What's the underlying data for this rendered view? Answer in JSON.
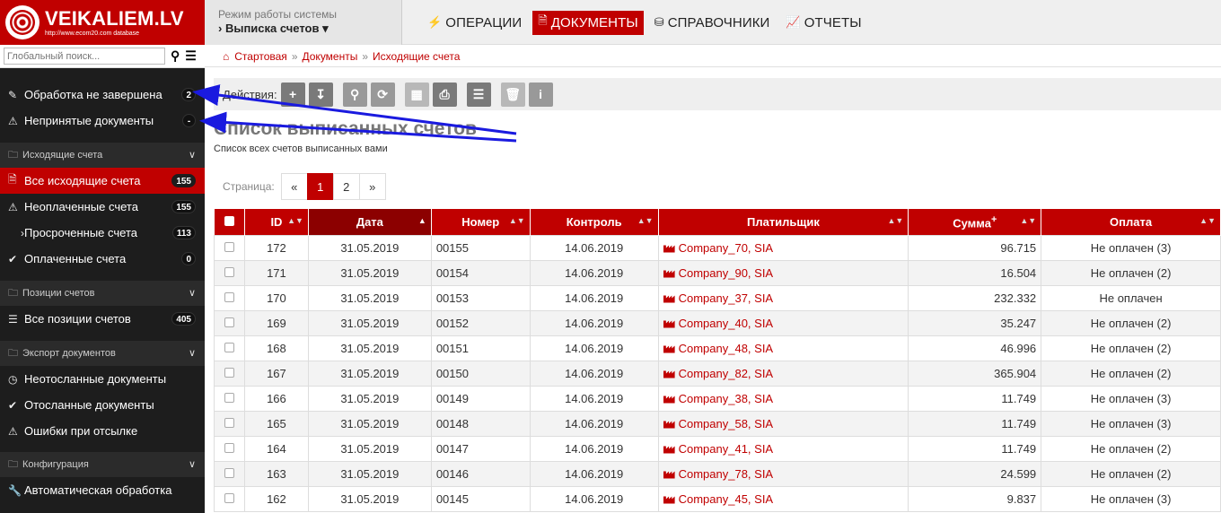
{
  "brand": {
    "title": "VEIKALIEM.LV",
    "subtitle": "http://www.ecom20.com database"
  },
  "search": {
    "placeholder": "Глобальный поиск..."
  },
  "sidebar": {
    "status": [
      {
        "label": "Обработка не завершена",
        "badge": "2",
        "icon": "edit-icon"
      },
      {
        "label": "Непринятые документы",
        "badge": "-",
        "icon": "warning-icon"
      }
    ],
    "groups": [
      {
        "title": "Исходящие счета",
        "items": [
          {
            "label": "Все исходящие счета",
            "badge": "155",
            "icon": "document-icon",
            "active": true
          },
          {
            "label": "Неоплаченные счета",
            "badge": "155",
            "icon": "warning-icon"
          },
          {
            "label": "Просроченные счета",
            "badge": "113",
            "icon": "chevron-right-icon"
          },
          {
            "label": "Оплаченные счета",
            "badge": "0",
            "icon": "check-icon"
          }
        ]
      },
      {
        "title": "Позиции счетов",
        "items": [
          {
            "label": "Все позиции счетов",
            "badge": "405",
            "icon": "list-icon"
          }
        ]
      },
      {
        "title": "Экспорт документов",
        "items": [
          {
            "label": "Неотосланные документы",
            "icon": "clock-icon"
          },
          {
            "label": "Отосланные документы",
            "icon": "check-icon"
          },
          {
            "label": "Ошибки при отсылке",
            "icon": "warning-icon"
          }
        ]
      },
      {
        "title": "Конфигурация",
        "items": [
          {
            "label": "Автоматическая обработка",
            "icon": "wrench-icon"
          }
        ]
      }
    ]
  },
  "topbar": {
    "mode_caption": "Режим работы системы",
    "mode_value": "Выписка счетов",
    "nav": [
      {
        "label": "ОПЕРАЦИИ",
        "icon": "bolt-icon"
      },
      {
        "label": "ДОКУМЕНТЫ",
        "icon": "document-icon",
        "active": true
      },
      {
        "label": "СПРАВОЧНИКИ",
        "icon": "database-icon"
      },
      {
        "label": "ОТЧЕТЫ",
        "icon": "chart-icon"
      }
    ]
  },
  "breadcrumb": [
    "Стартовая",
    "Документы",
    "Исходящие счета"
  ],
  "actions": {
    "caption": "Действия:"
  },
  "page": {
    "title": "Список выписанных счетов",
    "subtitle": "Список всех счетов выписанных вами"
  },
  "pager": {
    "caption": "Страница:",
    "prev": "«",
    "pages": [
      "1",
      "2"
    ],
    "next": "»",
    "current": "1"
  },
  "table": {
    "columns": [
      "ID",
      "Дата",
      "Номер",
      "Контроль",
      "Платильщик",
      "Сумма",
      "Оплата"
    ],
    "sum_marker": "+",
    "rows": [
      {
        "id": "172",
        "date": "31.05.2019",
        "num": "00155",
        "ctrl": "14.06.2019",
        "payer": "Company_70, SIA",
        "sum": "96.715",
        "pay": "Не оплачен (3)"
      },
      {
        "id": "171",
        "date": "31.05.2019",
        "num": "00154",
        "ctrl": "14.06.2019",
        "payer": "Company_90, SIA",
        "sum": "16.504",
        "pay": "Не оплачен (2)"
      },
      {
        "id": "170",
        "date": "31.05.2019",
        "num": "00153",
        "ctrl": "14.06.2019",
        "payer": "Company_37, SIA",
        "sum": "232.332",
        "pay": "Не оплачен"
      },
      {
        "id": "169",
        "date": "31.05.2019",
        "num": "00152",
        "ctrl": "14.06.2019",
        "payer": "Company_40, SIA",
        "sum": "35.247",
        "pay": "Не оплачен (2)"
      },
      {
        "id": "168",
        "date": "31.05.2019",
        "num": "00151",
        "ctrl": "14.06.2019",
        "payer": "Company_48, SIA",
        "sum": "46.996",
        "pay": "Не оплачен (2)"
      },
      {
        "id": "167",
        "date": "31.05.2019",
        "num": "00150",
        "ctrl": "14.06.2019",
        "payer": "Company_82, SIA",
        "sum": "365.904",
        "pay": "Не оплачен (2)"
      },
      {
        "id": "166",
        "date": "31.05.2019",
        "num": "00149",
        "ctrl": "14.06.2019",
        "payer": "Company_38, SIA",
        "sum": "11.749",
        "pay": "Не оплачен (3)"
      },
      {
        "id": "165",
        "date": "31.05.2019",
        "num": "00148",
        "ctrl": "14.06.2019",
        "payer": "Company_58, SIA",
        "sum": "11.749",
        "pay": "Не оплачен (3)"
      },
      {
        "id": "164",
        "date": "31.05.2019",
        "num": "00147",
        "ctrl": "14.06.2019",
        "payer": "Company_41, SIA",
        "sum": "11.749",
        "pay": "Не оплачен (2)"
      },
      {
        "id": "163",
        "date": "31.05.2019",
        "num": "00146",
        "ctrl": "14.06.2019",
        "payer": "Company_78, SIA",
        "sum": "24.599",
        "pay": "Не оплачен (2)"
      },
      {
        "id": "162",
        "date": "31.05.2019",
        "num": "00145",
        "ctrl": "14.06.2019",
        "payer": "Company_45, SIA",
        "sum": "9.837",
        "pay": "Не оплачен (3)"
      }
    ]
  },
  "colors": {
    "brand_red": "#c00000",
    "sidebar_bg": "#1d1d1d",
    "annotation_arrow": "#1a1adf"
  }
}
